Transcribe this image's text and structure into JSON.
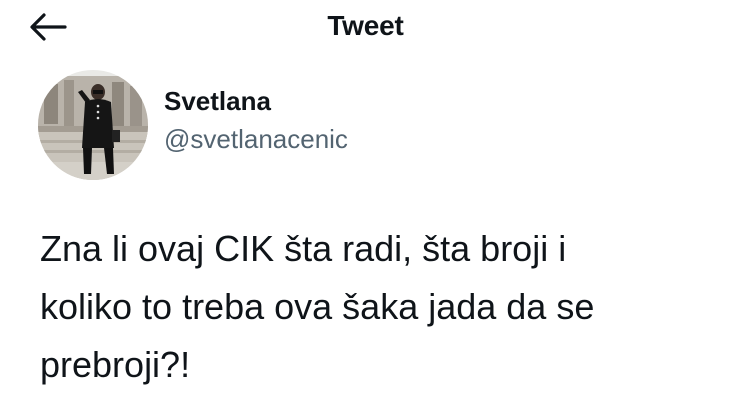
{
  "header": {
    "title": "Tweet",
    "back_icon": "arrow-left-icon"
  },
  "author": {
    "display_name": "Svetlana",
    "handle": "@svetlanacenic",
    "avatar": "profile-photo"
  },
  "tweet": {
    "text": "Zna li ovaj CIK šta radi, šta broji i\nkoliko to treba ova šaka jada da se\nprebroji?!"
  },
  "colors": {
    "text_primary": "#0f1419",
    "text_secondary": "#536471",
    "background": "#ffffff"
  }
}
